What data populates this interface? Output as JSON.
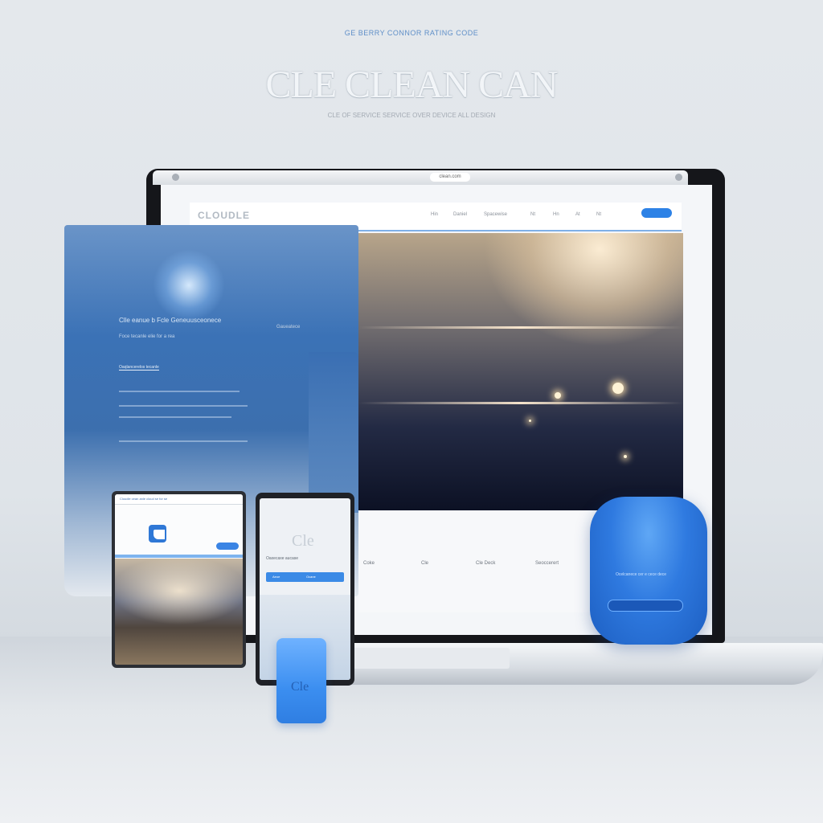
{
  "hero": {
    "tagline": "GE BERRY CONNOR RATING CODE",
    "title": "CLE CLEAN CAN",
    "subtitle": "CLE OF SERVICE SERVICE OVER DEVICE ALL DESIGN"
  },
  "browser": {
    "address": "clean.com"
  },
  "navbar": {
    "logo": "CLOUDLE",
    "items": [
      "Hin",
      "Daniel",
      "Spacewise",
      "Nt",
      "Hn",
      "At",
      "Nt"
    ]
  },
  "left_panel": {
    "title": "Clle eanue b Fcle Geneuusceonece",
    "subtitle": "Foce tecanle elie for a rea",
    "link": "Oaqlancerelos tecanle",
    "side_label": "Gaueatece"
  },
  "features": [
    "Coke",
    "Cle",
    "Cle Deck",
    "Seoccerert"
  ],
  "tablet": {
    "header": "Cloudle cean anle cloud se for se"
  },
  "phone": {
    "mark": "Cle",
    "text": "Oaxecaxe aucase",
    "tabs": [
      "Aeoe",
      "Ocane"
    ]
  },
  "device_text": "Ocelcanece cer e cece dece",
  "cube_label": "Cle",
  "colors": {
    "accent": "#2d82e6",
    "panel_blue": "#3b72b6",
    "background": "#e4e8ec"
  }
}
